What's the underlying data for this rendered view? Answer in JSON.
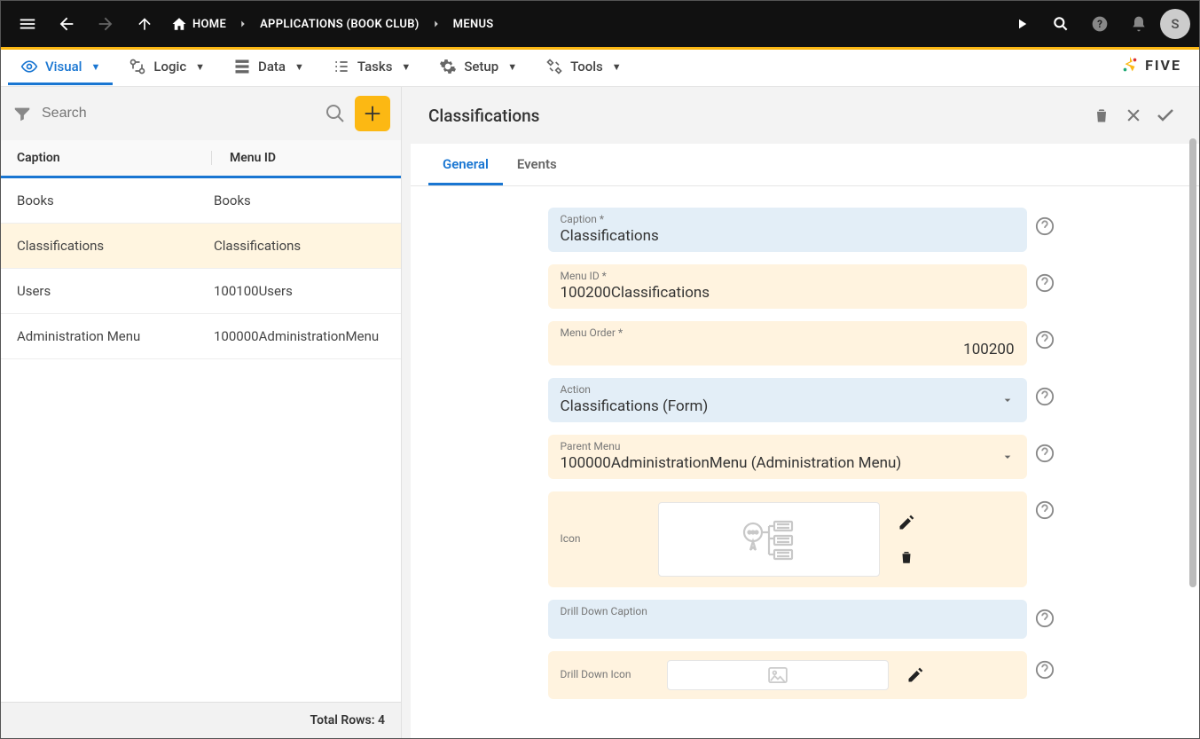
{
  "topbar": {
    "breadcrumbs": [
      {
        "label": "HOME",
        "has_home_icon": true
      },
      {
        "label": "APPLICATIONS (BOOK CLUB)"
      },
      {
        "label": "MENUS"
      }
    ],
    "avatar_initial": "S"
  },
  "menubar": {
    "items": [
      {
        "label": "Visual",
        "active": true,
        "icon": "eye"
      },
      {
        "label": "Logic",
        "active": false,
        "icon": "logic"
      },
      {
        "label": "Data",
        "active": false,
        "icon": "data"
      },
      {
        "label": "Tasks",
        "active": false,
        "icon": "tasks"
      },
      {
        "label": "Setup",
        "active": false,
        "icon": "setup"
      },
      {
        "label": "Tools",
        "active": false,
        "icon": "tools"
      }
    ],
    "brand": "FIVE"
  },
  "left": {
    "search_placeholder": "Search",
    "columns": {
      "col1": "Caption",
      "col2": "Menu ID"
    },
    "rows": [
      {
        "caption": "Books",
        "menu_id": "Books",
        "selected": false
      },
      {
        "caption": "Classifications",
        "menu_id": "Classifications",
        "selected": true
      },
      {
        "caption": "Users",
        "menu_id": "100100Users",
        "selected": false
      },
      {
        "caption": "Administration Menu",
        "menu_id": "100000AdministrationMenu",
        "selected": false
      }
    ],
    "footer": "Total Rows: 4"
  },
  "right": {
    "title": "Classifications",
    "tabs": [
      {
        "label": "General",
        "active": true
      },
      {
        "label": "Events",
        "active": false
      }
    ],
    "fields": {
      "caption": {
        "label": "Caption *",
        "value": "Classifications",
        "style": "blue"
      },
      "menu_id": {
        "label": "Menu ID *",
        "value": "100200Classifications",
        "style": "cream"
      },
      "menu_order": {
        "label": "Menu Order *",
        "value": "100200",
        "style": "cream",
        "align": "right"
      },
      "action": {
        "label": "Action",
        "value": "Classifications (Form)",
        "style": "blue",
        "dropdown": true
      },
      "parent_menu": {
        "label": "Parent Menu",
        "value": "100000AdministrationMenu (Administration Menu)",
        "style": "cream",
        "dropdown": true
      },
      "icon": {
        "label": "Icon",
        "value": "",
        "style": "cream",
        "is_icon_picker": true
      },
      "drill_down_caption": {
        "label": "Drill Down Caption",
        "value": "",
        "style": "blue"
      },
      "drill_down_icon": {
        "label": "Drill Down Icon",
        "value": "",
        "style": "cream",
        "is_icon_picker": true,
        "compact": true
      }
    }
  }
}
